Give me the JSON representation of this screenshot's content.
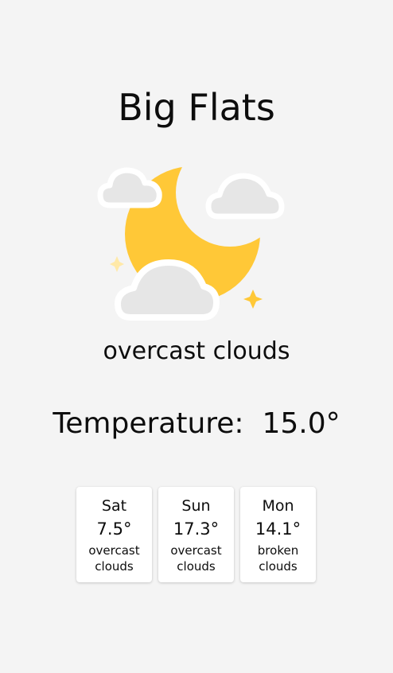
{
  "city": "Big Flats",
  "current": {
    "icon": "moon-cloud-icon",
    "condition": "overcast clouds",
    "temperature_label": "Temperature:",
    "temperature_value": "15.0°"
  },
  "colors": {
    "background": "#f4f4f4",
    "moon": "#ffc837",
    "cloud": "#e6e6e6",
    "sparkle": "#ffd35a"
  },
  "forecast": [
    {
      "day": "Sat",
      "temp": "7.5°",
      "desc": "overcast clouds"
    },
    {
      "day": "Sun",
      "temp": "17.3°",
      "desc": "overcast clouds"
    },
    {
      "day": "Mon",
      "temp": "14.1°",
      "desc": "broken clouds"
    }
  ]
}
